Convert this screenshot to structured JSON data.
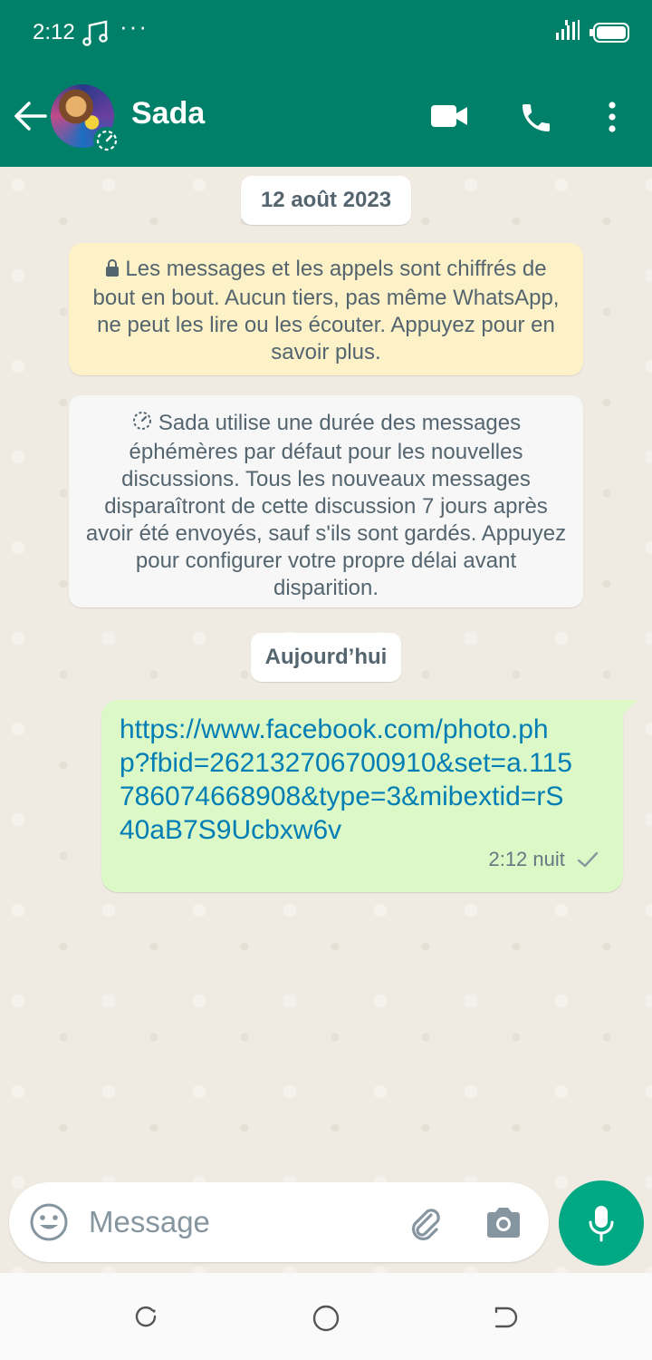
{
  "status_bar": {
    "time": "2:12",
    "dots": "···"
  },
  "header": {
    "contact_name": "Sada",
    "back_icon": "arrow-left-icon",
    "video_icon": "video-camera-icon",
    "call_icon": "phone-icon",
    "menu_icon": "more-vert-icon",
    "color": "#008069"
  },
  "chat": {
    "date_first": "12 août 2023",
    "encryption_notice": "Les messages et les appels sont chiffrés de bout en bout. Aucun tiers, pas même WhatsApp, ne peut les lire ou les écouter. Appuyez pour en savoir plus.",
    "ephemeral_notice": "Sada utilise une durée des messages éphémères par défaut pour les nouvelles discussions. Tous les nouveaux messages disparaîtront de cette discussion 7 jours après avoir été envoyés, sauf s'ils sont gardés. Appuyez pour configurer votre propre délai avant disparition.",
    "date_today": "Aujourd’hui",
    "messages": [
      {
        "text": "https://www.facebook.com/photo.php?fbid=262132706700910&set=a.115786074668908&type=3&mibextid=rS40aB7S9Ucbxw6v",
        "time": "2:12 nuit",
        "status": "sent"
      }
    ]
  },
  "input": {
    "placeholder": "Message"
  },
  "colors": {
    "accent": "#00a884",
    "link": "#027eb5",
    "outgoing_bubble": "#dcf8c6"
  }
}
